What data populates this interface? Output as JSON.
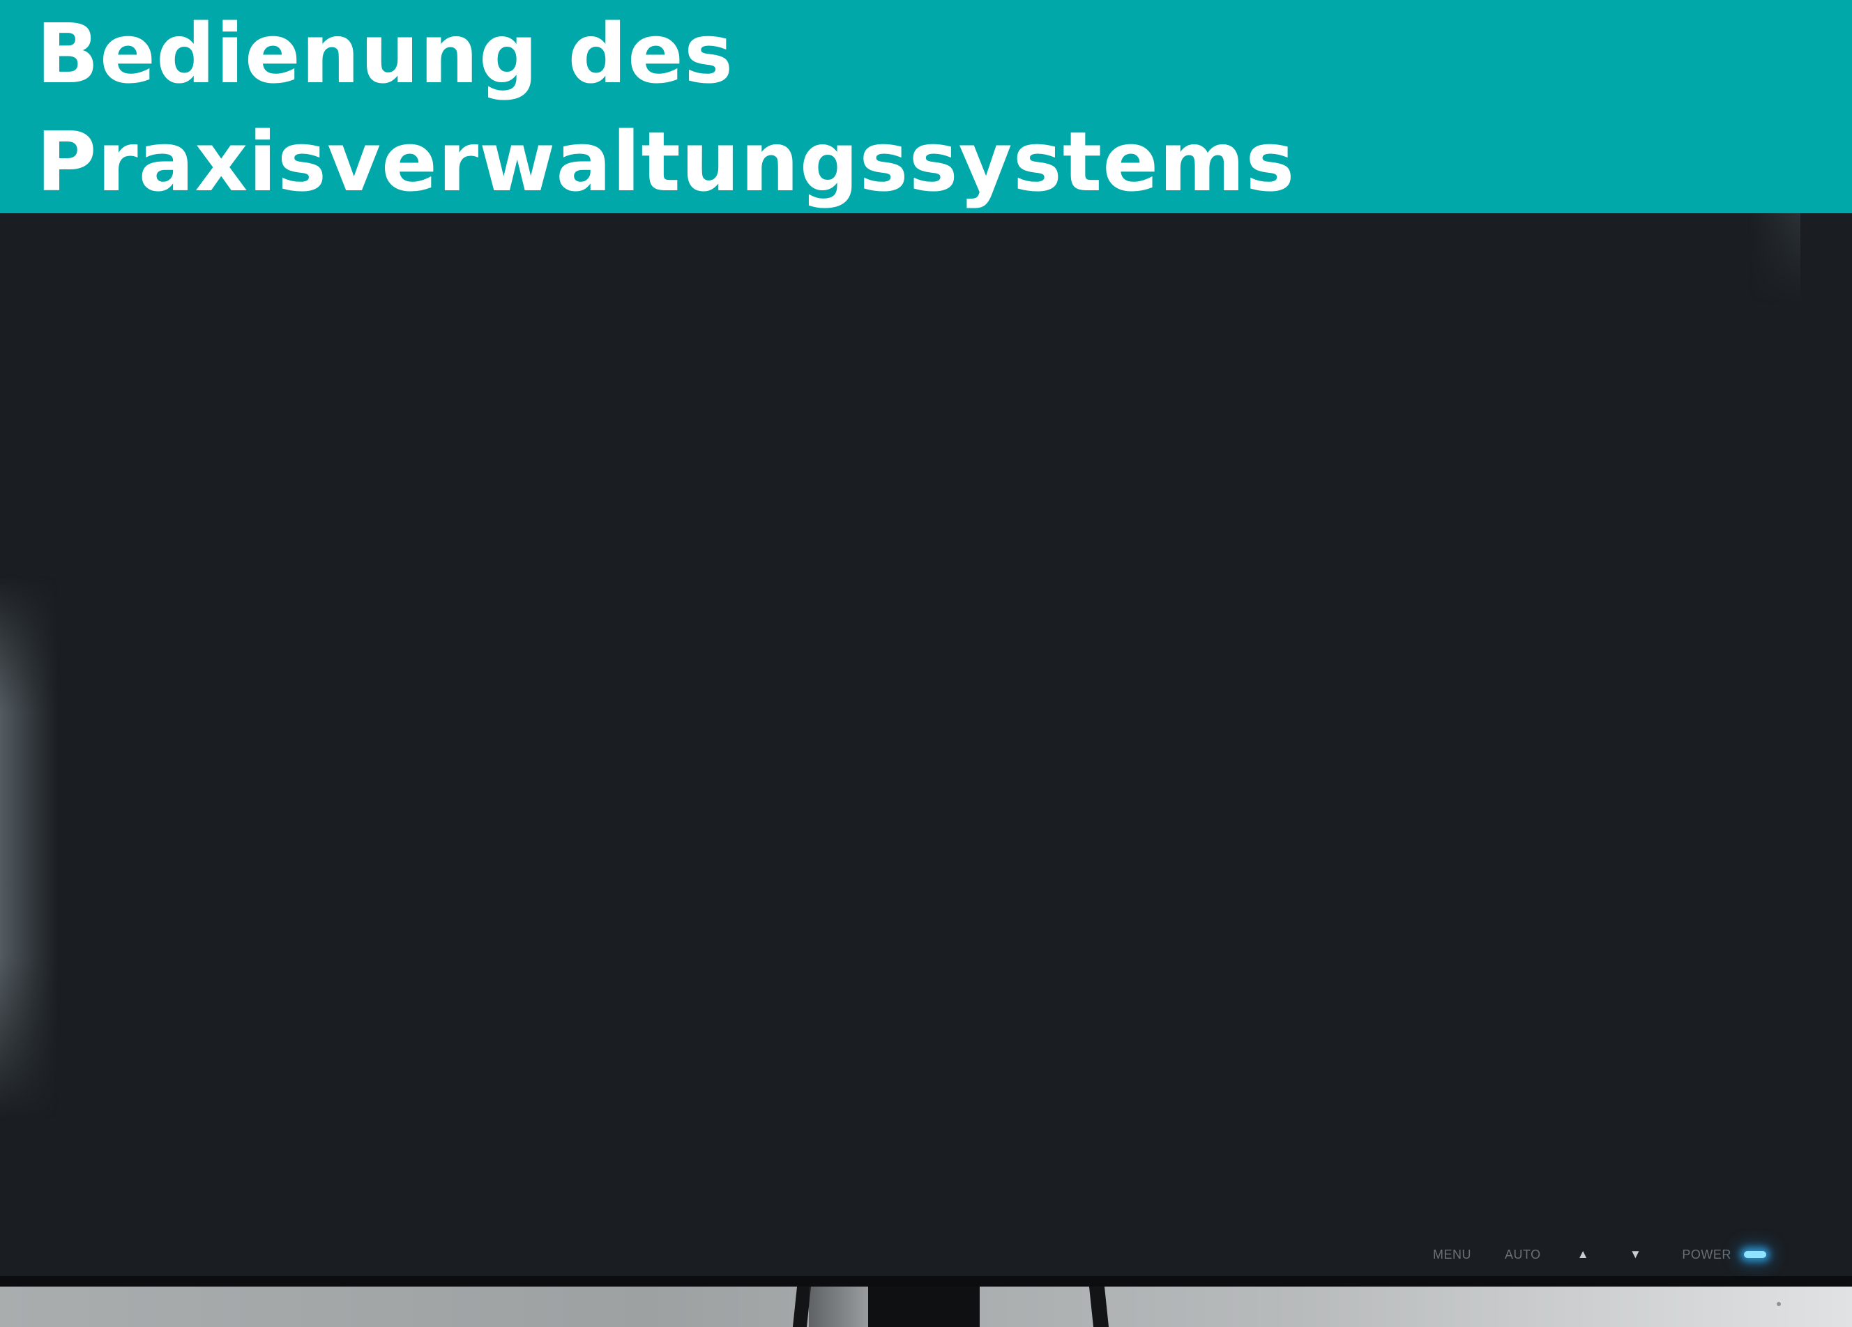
{
  "header": {
    "title_line1": "Bedienung des",
    "title_line2": "Praxisverwaltungssystems",
    "background_color": "#00a8a9",
    "text_color": "#ffffff"
  },
  "monitor": {
    "screen_color": "#1a1e22",
    "controls": {
      "menu": "MENU",
      "auto": "AUTO",
      "up_icon": "▲",
      "down_icon": "▼",
      "power": "POWER",
      "power_led_color": "#8fe3ff"
    }
  }
}
